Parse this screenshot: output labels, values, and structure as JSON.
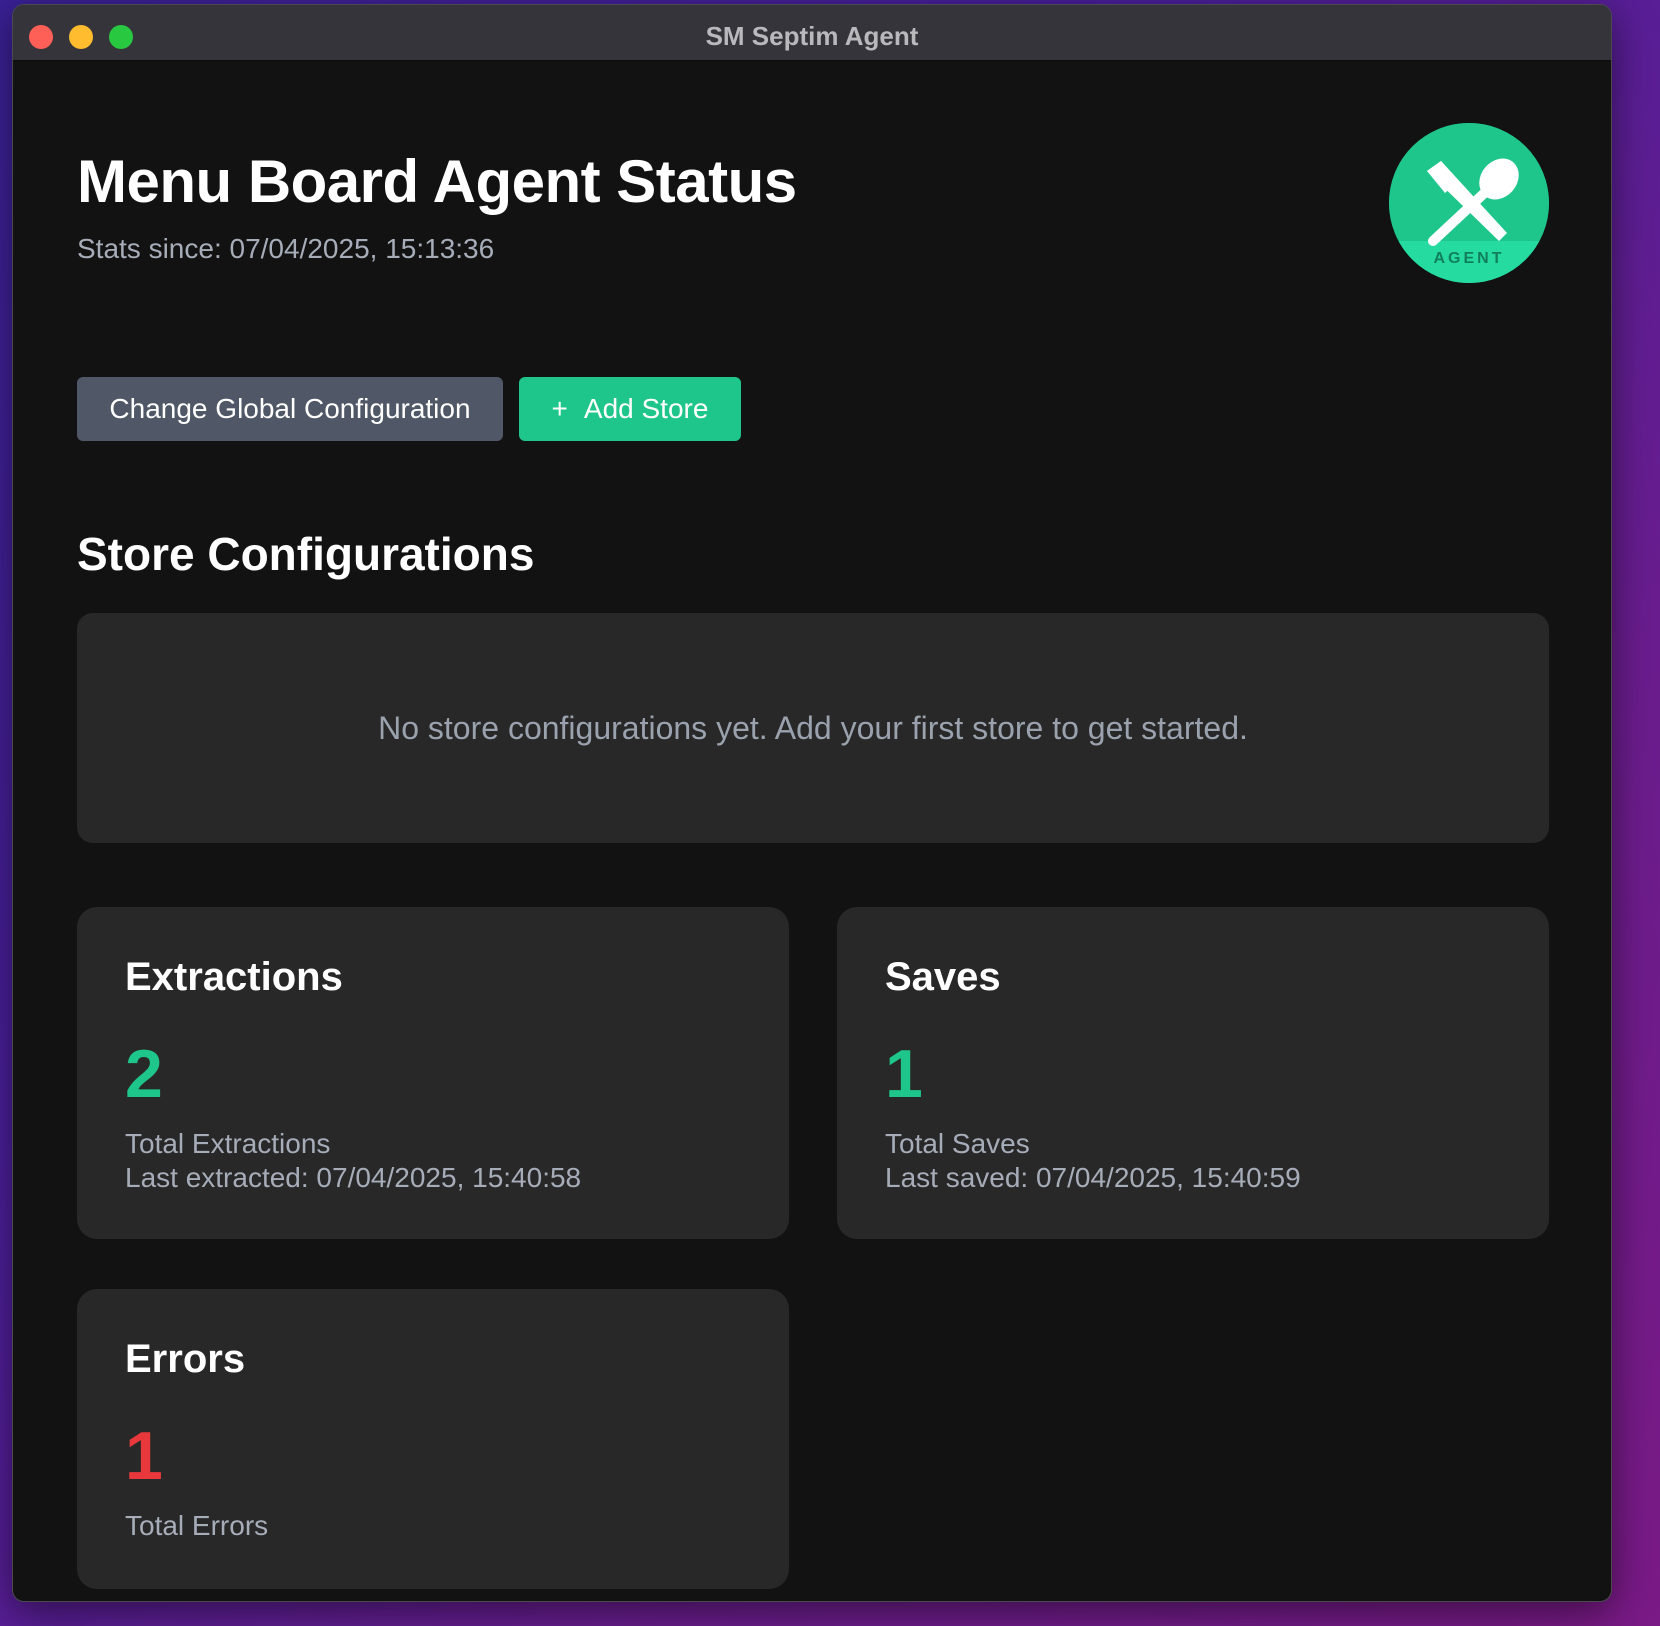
{
  "window": {
    "title": "SM Septim Agent"
  },
  "header": {
    "title": "Menu Board Agent Status",
    "stats_since": "Stats since: 07/04/2025, 15:13:36",
    "logo_text": "AGENT"
  },
  "actions": {
    "change_config_label": "Change Global Configuration",
    "add_store_icon": "+",
    "add_store_label": "Add Store"
  },
  "stores": {
    "section_title": "Store Configurations",
    "empty_message": "No store configurations yet. Add your first store to get started."
  },
  "stats": {
    "extractions": {
      "title": "Extractions",
      "value": "2",
      "label": "Total Extractions",
      "last": "Last extracted: 07/04/2025, 15:40:58"
    },
    "saves": {
      "title": "Saves",
      "value": "1",
      "label": "Total Saves",
      "last": "Last saved: 07/04/2025, 15:40:59"
    },
    "errors": {
      "title": "Errors",
      "value": "1",
      "label": "Total Errors"
    }
  },
  "colors": {
    "accent": "#1ec68c",
    "error": "#e8383b",
    "background": "#121212",
    "card": "#282828",
    "secondary_button": "#505766"
  }
}
